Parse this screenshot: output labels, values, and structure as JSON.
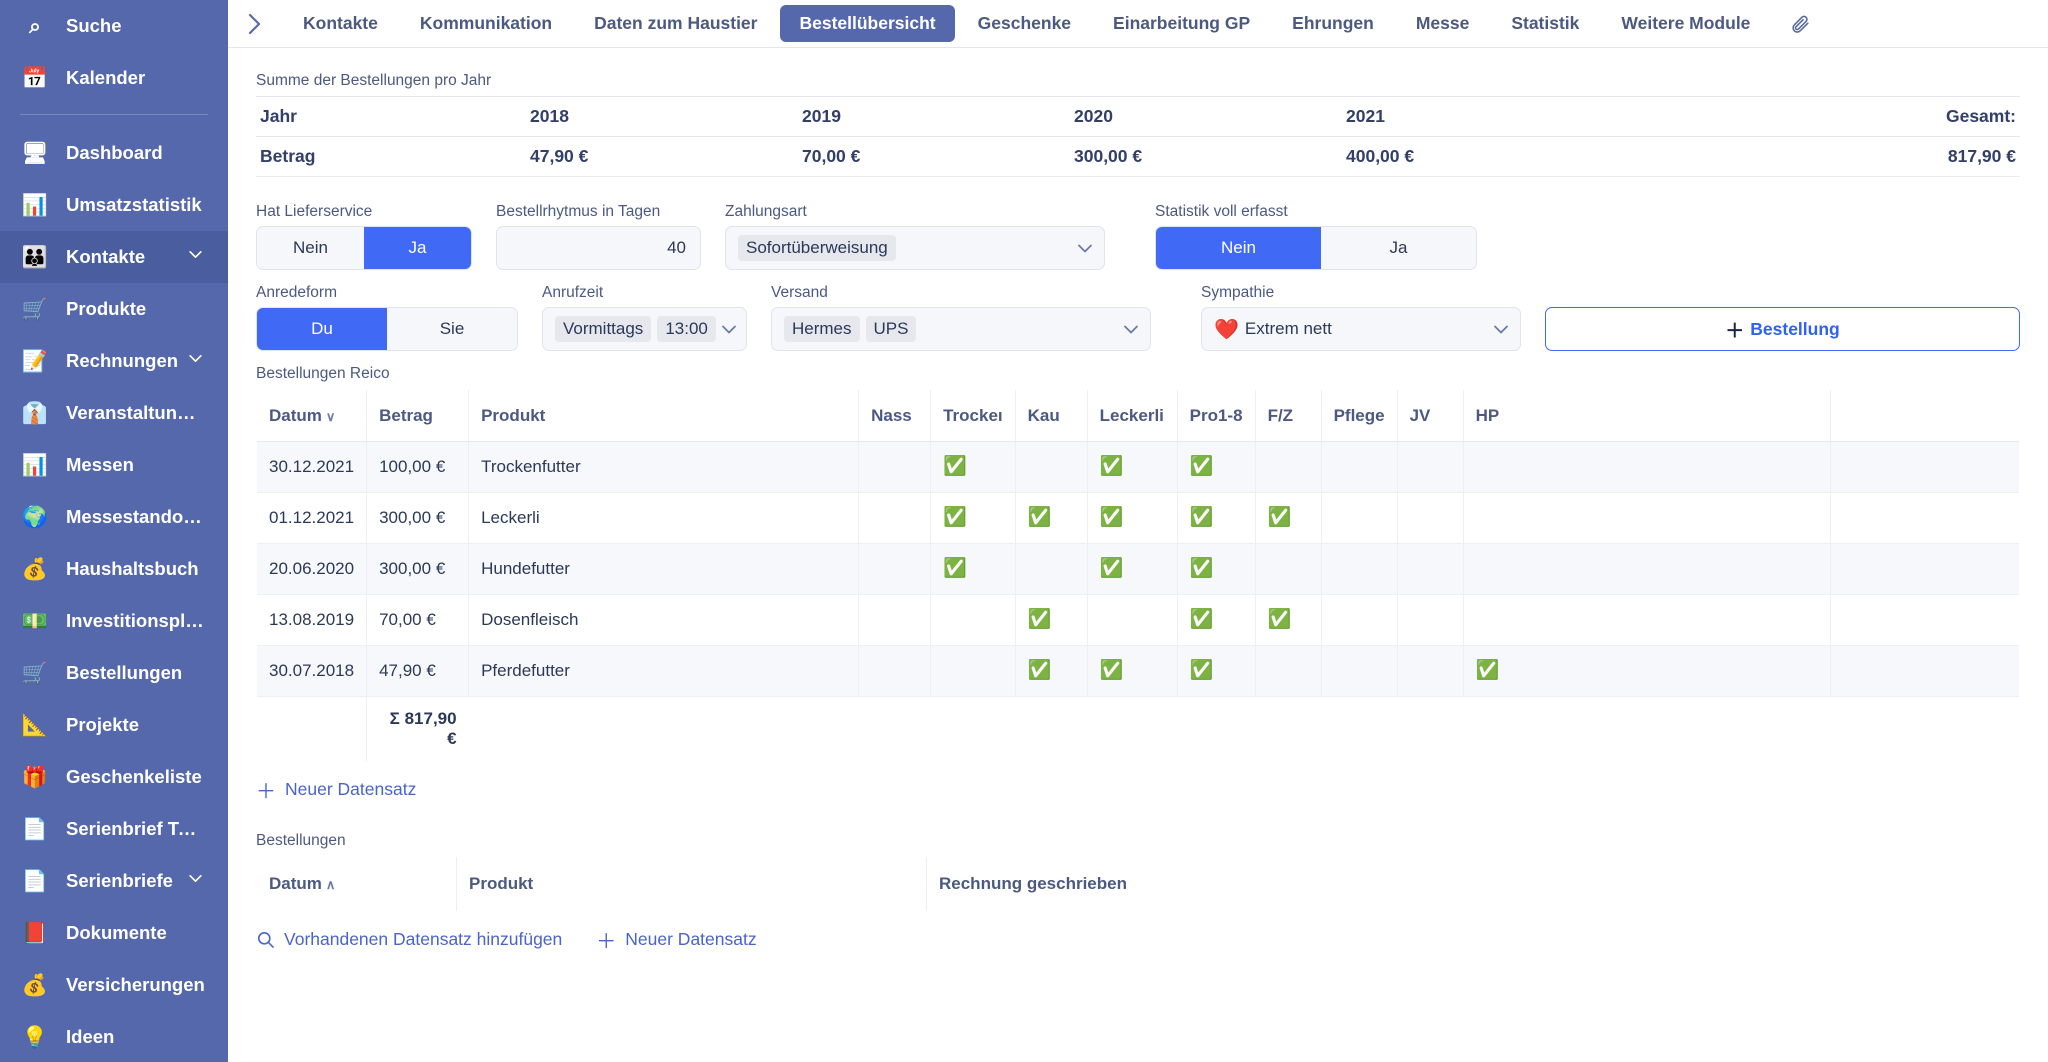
{
  "sidebar": {
    "top_items": [
      {
        "label": "Suche",
        "icon": "search-icon",
        "glyph": "⌕",
        "chevron": false
      },
      {
        "label": "Kalender",
        "icon": "calendar-icon",
        "glyph": "📅",
        "chevron": false
      }
    ],
    "items": [
      {
        "label": "Dashboard",
        "icon": "monitor-icon",
        "glyph": "🖥",
        "chevron": false,
        "active": false
      },
      {
        "label": "Umsatzstatistik",
        "icon": "pie-chart-icon",
        "glyph": "📊",
        "chevron": false,
        "active": false
      },
      {
        "label": "Kontakte",
        "icon": "people-icon",
        "glyph": "👪",
        "chevron": true,
        "active": true
      },
      {
        "label": "Produkte",
        "icon": "shopping-cart-icon",
        "glyph": "🛒",
        "chevron": false,
        "active": false
      },
      {
        "label": "Rechnungen",
        "icon": "invoice-icon",
        "glyph": "📝",
        "chevron": true,
        "active": false
      },
      {
        "label": "Veranstaltungen",
        "icon": "necktie-icon",
        "glyph": "👔",
        "chevron": false,
        "active": false
      },
      {
        "label": "Messen",
        "icon": "bar-chart-icon",
        "glyph": "📊",
        "chevron": false,
        "active": false
      },
      {
        "label": "Messestandorte",
        "icon": "globe-icon",
        "glyph": "🌍",
        "chevron": false,
        "active": false
      },
      {
        "label": "Haushaltsbuch",
        "icon": "money-bag-icon",
        "glyph": "💰",
        "chevron": false,
        "active": false
      },
      {
        "label": "Investitionsplan",
        "icon": "banknotes-icon",
        "glyph": "💵",
        "chevron": false,
        "active": false
      },
      {
        "label": "Bestellungen",
        "icon": "cart-plus-icon",
        "glyph": "🛒",
        "chevron": false,
        "active": false
      },
      {
        "label": "Projekte",
        "icon": "ruler-pencil-icon",
        "glyph": "📐",
        "chevron": false,
        "active": false
      },
      {
        "label": "Geschenkeliste",
        "icon": "gift-icon",
        "glyph": "🎁",
        "chevron": false,
        "active": false
      },
      {
        "label": "Serienbrief Textb...",
        "icon": "document-icon",
        "glyph": "📄",
        "chevron": false,
        "active": false
      },
      {
        "label": "Serienbriefe",
        "icon": "document-icon",
        "glyph": "📄",
        "chevron": true,
        "active": false
      },
      {
        "label": "Dokumente",
        "icon": "books-icon",
        "glyph": "📕",
        "chevron": false,
        "active": false
      },
      {
        "label": "Versicherungen",
        "icon": "money-bag-icon",
        "glyph": "💰",
        "chevron": false,
        "active": false
      },
      {
        "label": "Ideen",
        "icon": "lightbulb-icon",
        "glyph": "💡",
        "chevron": false,
        "active": false
      }
    ]
  },
  "tabs": [
    {
      "label": "Kontakte",
      "active": false
    },
    {
      "label": "Kommunikation",
      "active": false
    },
    {
      "label": "Daten zum Haustier",
      "active": false
    },
    {
      "label": "Bestellübersicht",
      "active": true
    },
    {
      "label": "Geschenke",
      "active": false
    },
    {
      "label": "Einarbeitung GP",
      "active": false
    },
    {
      "label": "Ehrungen",
      "active": false
    },
    {
      "label": "Messe",
      "active": false
    },
    {
      "label": "Statistik",
      "active": false
    },
    {
      "label": "Weitere Module",
      "active": false
    }
  ],
  "attachment_icon": "📎",
  "year_summary": {
    "title": "Summe der Bestellungen pro Jahr",
    "row_labels": [
      "Jahr",
      "Betrag"
    ],
    "years": [
      "2018",
      "2019",
      "2020",
      "2021"
    ],
    "amounts": [
      "47,90 €",
      "70,00 €",
      "300,00 €",
      "400,00 €"
    ],
    "total_label": "Gesamt:",
    "total_value": "817,90 €"
  },
  "form": {
    "lieferservice": {
      "label": "Hat Lieferservice",
      "options": [
        "Nein",
        "Ja"
      ],
      "selected": "Ja"
    },
    "rhythmus": {
      "label": "Bestellrhytmus in Tagen",
      "value": "40"
    },
    "zahlungsart": {
      "label": "Zahlungsart",
      "value": "Sofortüberweisung"
    },
    "statistik": {
      "label": "Statistik voll erfasst",
      "options": [
        "Nein",
        "Ja"
      ],
      "selected": "Nein"
    },
    "anredeform": {
      "label": "Anredeform",
      "options": [
        "Du",
        "Sie"
      ],
      "selected": "Du"
    },
    "anrufzeit": {
      "label": "Anrufzeit",
      "tags": [
        "Vormittags",
        "13:00"
      ]
    },
    "versand": {
      "label": "Versand",
      "tags": [
        "Hermes",
        "UPS"
      ]
    },
    "sympathie": {
      "label": "Sympathie",
      "value": "Extrem nett",
      "emoji": "❤️"
    },
    "add_order_button": {
      "plus": "＋",
      "label": "Bestellung"
    }
  },
  "orders": {
    "title": "Bestellungen Reico",
    "columns": [
      "Datum",
      "Betrag",
      "Produkt",
      "Nass",
      "Trockeı",
      "Kau",
      "Leckerli",
      "Pro1-8",
      "F/Z",
      "Pflege",
      "JV",
      "HP",
      ""
    ],
    "sort_column": "Datum",
    "sort_dir": "∨",
    "rows": [
      {
        "datum": "30.12.2021",
        "betrag": "100,00 €",
        "produkt": "Trockenfutter",
        "checks": {
          "Nass": false,
          "Trocken": true,
          "Kau": false,
          "Leckerli": true,
          "Pro1-8": true,
          "F/Z": false,
          "Pflege": false,
          "JV": false,
          "HP": false
        }
      },
      {
        "datum": "01.12.2021",
        "betrag": "300,00 €",
        "produkt": "Leckerli",
        "checks": {
          "Nass": false,
          "Trocken": true,
          "Kau": true,
          "Leckerli": true,
          "Pro1-8": true,
          "F/Z": true,
          "Pflege": false,
          "JV": false,
          "HP": false
        }
      },
      {
        "datum": "20.06.2020",
        "betrag": "300,00 €",
        "produkt": "Hundefutter",
        "checks": {
          "Nass": false,
          "Trocken": true,
          "Kau": false,
          "Leckerli": true,
          "Pro1-8": true,
          "F/Z": false,
          "Pflege": false,
          "JV": false,
          "HP": false
        }
      },
      {
        "datum": "13.08.2019",
        "betrag": "70,00 €",
        "produkt": "Dosenfleisch",
        "checks": {
          "Nass": false,
          "Trocken": false,
          "Kau": true,
          "Leckerli": false,
          "Pro1-8": true,
          "F/Z": true,
          "Pflege": false,
          "JV": false,
          "HP": false
        }
      },
      {
        "datum": "30.07.2018",
        "betrag": "47,90 €",
        "produkt": "Pferdefutter",
        "checks": {
          "Nass": false,
          "Trocken": false,
          "Kau": true,
          "Leckerli": true,
          "Pro1-8": true,
          "F/Z": false,
          "Pflege": false,
          "JV": false,
          "HP": true
        }
      }
    ],
    "sum_label": "Σ 817,90 €",
    "new_record_link": {
      "icon": "＋",
      "label": "Neuer Datensatz"
    }
  },
  "orders2": {
    "title": "Bestellungen",
    "columns": [
      "Datum",
      "Produkt",
      "Rechnung geschrieben"
    ],
    "sort_column": "Datum",
    "sort_dir": "∧",
    "links": [
      {
        "icon": "search-icon",
        "glyph": "⌕",
        "label": "Vorhandenen Datensatz hinzufügen"
      },
      {
        "icon": "plus-icon",
        "glyph": "＋",
        "label": "Neuer Datensatz"
      }
    ]
  },
  "colors": {
    "sidebar_bg": "#5468ab",
    "sidebar_active": "#4a5d9e",
    "accent_blue": "#4069f5",
    "tab_active_bg": "#5468ab",
    "link_blue": "#4a63c9",
    "check_green": "#2fae3e",
    "heart_red": "#e8222a",
    "text_dark": "#2b3857",
    "text_muted": "#4c5980"
  }
}
